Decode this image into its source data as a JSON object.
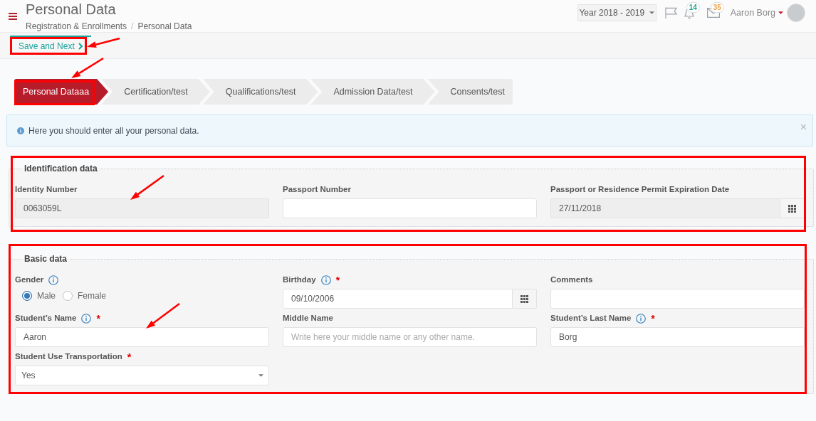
{
  "header": {
    "title": "Personal Data",
    "breadcrumb": {
      "items": [
        "Registration & Enrollments",
        "Personal Data"
      ],
      "separator": "/"
    },
    "year_selector": "Year 2018 - 2019",
    "notifications": {
      "count": "14"
    },
    "messages": {
      "count": "35"
    },
    "user": {
      "name": "Aaron Borg"
    }
  },
  "toolbar": {
    "save_button": "Save and Next"
  },
  "wizard_steps": [
    {
      "label": "Personal Dataaa",
      "selected": true
    },
    {
      "label": "Certification/test",
      "selected": false
    },
    {
      "label": "Qualifications/test",
      "selected": false
    },
    {
      "label": "Admission Data/test",
      "selected": false
    },
    {
      "label": "Consents/test",
      "selected": false
    }
  ],
  "alert": {
    "text": "Here you should enter all your personal data.",
    "close": "×"
  },
  "sections": [
    {
      "legend": "Identification data",
      "fields": [
        {
          "kind": "text",
          "label": "Identity Number",
          "value": "0063059L",
          "disabled": true
        },
        {
          "kind": "text",
          "label": "Passport Number",
          "disabled": false
        },
        {
          "kind": "date",
          "label": "Passport or Residence Permit Expiration Date",
          "value": "27/11/2018",
          "disabled": true
        }
      ]
    },
    {
      "legend": "Basic data",
      "fields": [
        {
          "kind": "radio",
          "label": "Gender",
          "info": true,
          "options": [
            {
              "label": "Male",
              "selected": true
            },
            {
              "label": "Female",
              "selected": false
            }
          ]
        },
        {
          "kind": "date",
          "label": "Birthday",
          "info": true,
          "required_mark": "*",
          "value": "09/10/2006",
          "disabled": false
        },
        {
          "kind": "text",
          "label": "Comments",
          "disabled": false
        },
        {
          "kind": "text",
          "label": "Student’s Name",
          "info": true,
          "required_mark": "*",
          "value": "Aaron",
          "disabled": false
        },
        {
          "kind": "text",
          "label": "Middle Name",
          "placeholder": "Write here your middle name or any other name.",
          "disabled": false
        },
        {
          "kind": "text",
          "label": "Student’s Last Name",
          "info": true,
          "required_mark": "*",
          "value": "Borg",
          "disabled": false
        },
        {
          "kind": "select",
          "label": "Student Use Transportation",
          "required_mark": "*",
          "value": "Yes",
          "disabled": false
        }
      ]
    }
  ]
}
